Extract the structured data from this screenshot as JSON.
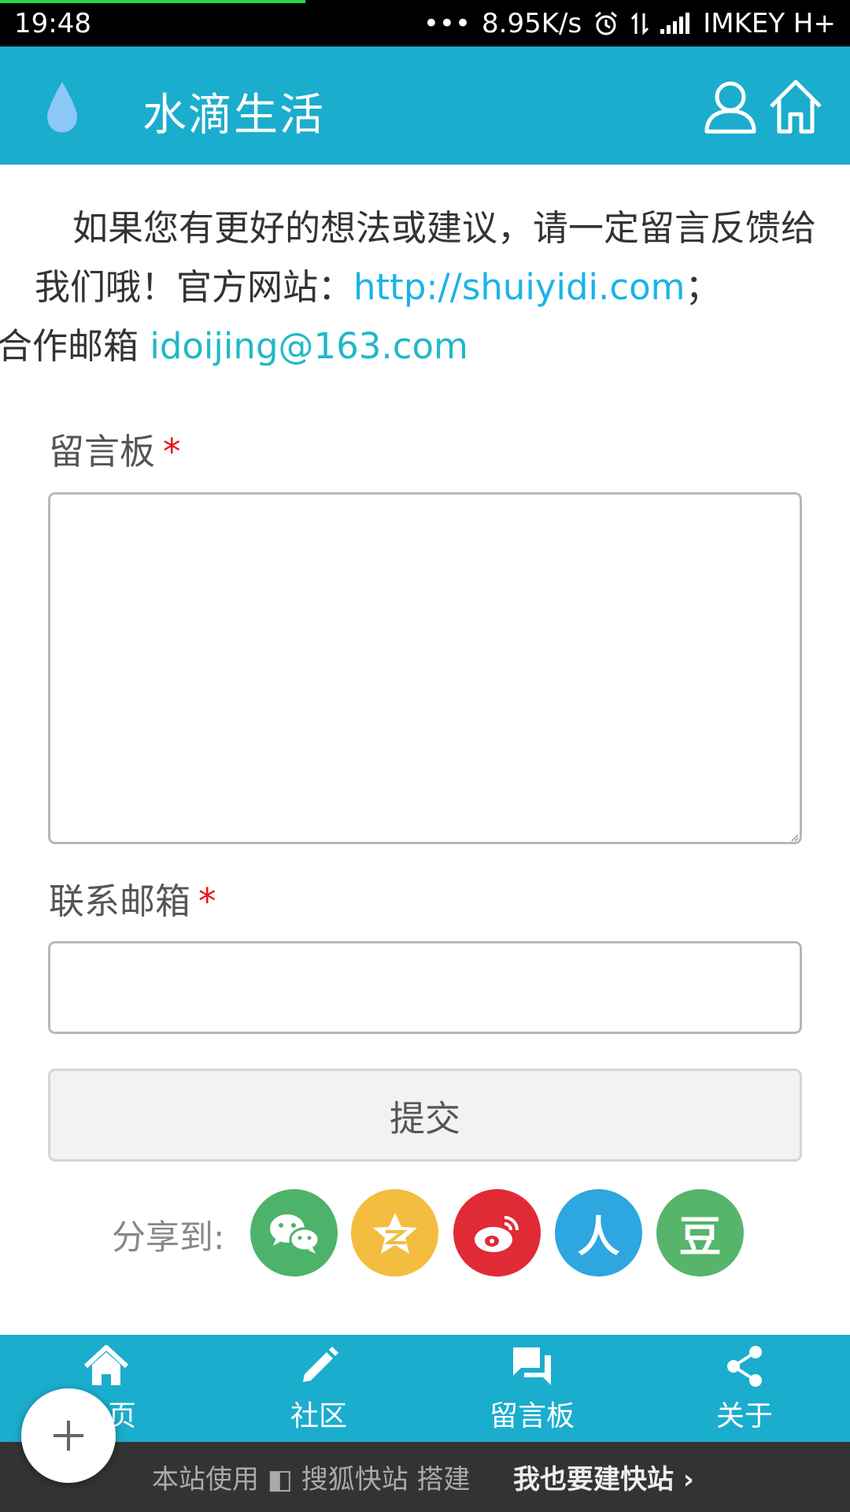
{
  "status_bar": {
    "time": "19:48",
    "dots": "•••",
    "speed": "8.95K/s",
    "alarm_icon": "alarm-icon",
    "data_icon": "data-transfer-icon",
    "signal_icon": "signal-icon",
    "carrier": "IMKEY H+",
    "progress_fraction": 0.36
  },
  "header": {
    "title": "水滴生活",
    "logo_icon": "water-drop-icon",
    "user_icon": "user-icon",
    "home_icon": "home-icon"
  },
  "intro": {
    "text_before_link": "如果您有更好的想法或建议，请一定留言反馈给我们哦！官方网站：",
    "website": "http://shuiyidi.com",
    "separator": "；",
    "mail_label": "合作邮箱 ",
    "email": "idoijing@163.com"
  },
  "form": {
    "message_label": "留言板",
    "email_label": "联系邮箱",
    "required_mark": "*",
    "message_value": "",
    "email_value": "",
    "submit_label": "提交"
  },
  "share": {
    "label": "分享到:",
    "buttons": [
      {
        "name": "wechat",
        "glyph": "",
        "color": "#4db36a"
      },
      {
        "name": "qzone",
        "glyph": "",
        "color": "#f3bd3f"
      },
      {
        "name": "weibo",
        "glyph": "",
        "color": "#e02b36"
      },
      {
        "name": "renren",
        "glyph": "人",
        "color": "#2ea6e0"
      },
      {
        "name": "douban",
        "glyph": "豆",
        "color": "#56b56b"
      }
    ]
  },
  "bottom_nav": {
    "items": [
      {
        "label": "页",
        "icon": "home-icon"
      },
      {
        "label": "社区",
        "icon": "pencil-icon"
      },
      {
        "label": "留言板",
        "icon": "chat-icon"
      },
      {
        "label": "关于",
        "icon": "share-icon"
      }
    ]
  },
  "footer": {
    "left_text": "本站使用 ◧ 搜狐快站 搭建",
    "right_text": "我也要建快站 ›"
  },
  "fab": {
    "icon": "plus-icon"
  },
  "colors": {
    "brand": "#1badcd",
    "link": "#19b3e8",
    "required": "#e8151a"
  }
}
